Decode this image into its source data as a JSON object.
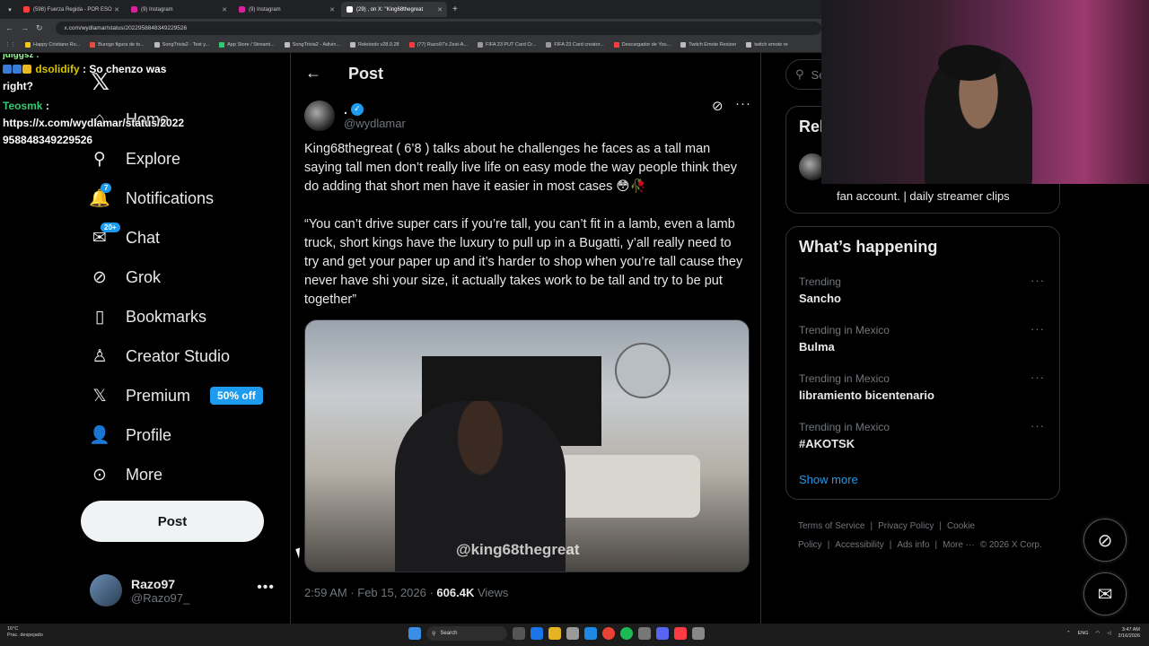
{
  "browser": {
    "tabs": [
      {
        "title": "(598) Fuerza Regida - POR ESO",
        "color": "#ff3b3b",
        "active": false
      },
      {
        "title": "(9) Instagram",
        "color": "#d6249f",
        "active": false
      },
      {
        "title": "(9) Instagram",
        "color": "#d6249f",
        "active": false
      },
      {
        "title": "(29) , on X: \"King68thegreat",
        "color": "#ffffff",
        "active": true
      }
    ],
    "url": "x.com/wydlamar/status/2022958848349229526",
    "bookmarks": [
      {
        "label": "Happy Cristiano Ro...",
        "color": "#f5c518"
      },
      {
        "label": "Burego figura de to...",
        "color": "#e74c3c"
      },
      {
        "label": "SongTrivia2 - Test y...",
        "color": "#bbbbbb"
      },
      {
        "label": "App Store / Streami...",
        "color": "#2ecc71"
      },
      {
        "label": "SongTrivia2 - Adivin...",
        "color": "#bbbbbb"
      },
      {
        "label": "Reletools v28.0.28",
        "color": "#bbbbbb"
      },
      {
        "label": "(77) Razo97's Zest-A...",
        "color": "#ff3b3b"
      },
      {
        "label": "FIFA 23 PUT Card Cr...",
        "color": "#999999"
      },
      {
        "label": "FIFA 23 Card creator...",
        "color": "#999999"
      },
      {
        "label": "Descargador de You...",
        "color": "#ff3b3b"
      },
      {
        "label": "Twitch Emote Resizer",
        "color": "#bbbbbb"
      },
      {
        "label": "twitch emote re",
        "color": "#bbbbbb"
      }
    ]
  },
  "chat": {
    "prefix_partial": "jdiggsz :",
    "msg1_user": "dsolidify",
    "msg1_text": ": So chenzo was right?",
    "msg2_user": "Teosmk",
    "msg2_sep": ":",
    "msg2_text": "https://x.com/wydlamar/status/2022958848349229526"
  },
  "sidebar": {
    "items": [
      {
        "label": "Home",
        "icon": "home-icon",
        "glyph": "⌂",
        "badge": ""
      },
      {
        "label": "Explore",
        "icon": "search-icon",
        "glyph": "⚲",
        "badge": ""
      },
      {
        "label": "Notifications",
        "icon": "bell-icon",
        "glyph": "🔔",
        "badge": "7"
      },
      {
        "label": "Chat",
        "icon": "mail-icon",
        "glyph": "✉",
        "badge": "20+"
      },
      {
        "label": "Grok",
        "icon": "grok-icon",
        "glyph": "⊘",
        "badge": ""
      },
      {
        "label": "Bookmarks",
        "icon": "bookmark-icon",
        "glyph": "▯",
        "badge": ""
      },
      {
        "label": "Creator Studio",
        "icon": "creator-studio-icon",
        "glyph": "♙",
        "badge": ""
      },
      {
        "label": "Premium",
        "icon": "x-premium-icon",
        "glyph": "𝕏",
        "badge": "",
        "promo": "50% off"
      },
      {
        "label": "Profile",
        "icon": "person-icon",
        "glyph": "👤",
        "badge": ""
      },
      {
        "label": "More",
        "icon": "more-circle-icon",
        "glyph": "⊙",
        "badge": ""
      }
    ],
    "post_button": "Post",
    "account": {
      "name": "Razo97",
      "handle": "@Razo97_"
    }
  },
  "main": {
    "title": "Post",
    "author_name": ".",
    "author_handle": "@wydlamar",
    "paragraph1": "King68thegreat ( 6’8 ) talks about he challenges he faces as a tall man saying tall men don’t really live life on easy mode the way people think they do adding that short men have it easier in most cases 😳🥀",
    "paragraph2": "“You can’t drive super cars if you’re tall, you can’t fit in a lamb, even a lamb truck, short kings have the luxury to pull up in a Bugatti, y’all really need to try and get your paper up and it’s harder to shop when you’re tall cause they never have shi your size, it actually takes work to be tall and try to be put together”",
    "media_watermark": "@king68thegreat",
    "timestamp": "2:59 AM · Feb 15, 2026 · ",
    "views_count": "606.4K",
    "views_label": " Views"
  },
  "right": {
    "search_placeholder": "Se",
    "relevant_title": "Rel",
    "relevant_bio": "fan account. | daily streamer clips",
    "happening_title": "What’s happening",
    "trends": [
      {
        "context": "Trending",
        "name": "Sancho"
      },
      {
        "context": "Trending in Mexico",
        "name": "Bulma"
      },
      {
        "context": "Trending in Mexico",
        "name": "libramiento bicentenario"
      },
      {
        "context": "Trending in Mexico",
        "name": "#AKOTSK"
      }
    ],
    "show_more": "Show more",
    "footer": [
      "Terms of Service",
      "|",
      "Privacy Policy",
      "|",
      "Cookie Policy",
      "|",
      "Accessibility",
      "|",
      "Ads info",
      "|",
      "More ···",
      "© 2026 X Corp."
    ]
  },
  "taskbar": {
    "weather_temp": "16°C",
    "weather_desc": "Prac. despejado",
    "search_label": "Search",
    "lang": "ENG",
    "time": "3:47 AM",
    "date": "2/16/2026"
  }
}
